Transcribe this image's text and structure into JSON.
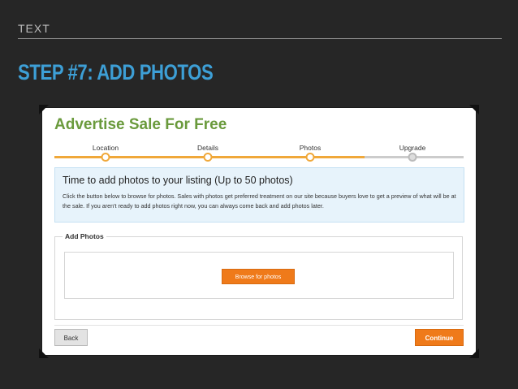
{
  "slide": {
    "tag": "TEXT",
    "title": "STEP #7: ADD PHOTOS"
  },
  "app": {
    "title": "Advertise Sale For Free",
    "steps": [
      {
        "label": "Location",
        "state": "done"
      },
      {
        "label": "Details",
        "state": "done"
      },
      {
        "label": "Photos",
        "state": "current"
      },
      {
        "label": "Upgrade",
        "state": "todo"
      }
    ],
    "info": {
      "heading": "Time to add photos to your listing (Up to 50 photos)",
      "body": "Click the button below to browse for photos. Sales with photos get preferred treatment on our site because buyers love to get a preview of what will be at the sale. If you aren't ready to add photos right now, you can always come back and add photos later."
    },
    "photos_section": {
      "legend": "Add Photos",
      "browse_label": "Browse for photos"
    },
    "footer": {
      "back_label": "Back",
      "continue_label": "Continue"
    }
  },
  "colors": {
    "background": "#262626",
    "slide_title": "#3d9fd6",
    "app_title": "#6a9a3c",
    "progress": "#f0a83a",
    "primary_button": "#ef7a1a",
    "info_bg": "#e7f3fb"
  }
}
